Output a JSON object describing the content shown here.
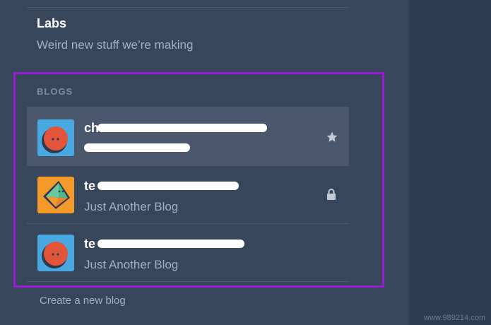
{
  "labs": {
    "title": "Labs",
    "subtitle": "Weird new stuff we’re making"
  },
  "blogs_section": {
    "header": "BLOGS",
    "items": [
      {
        "name_visible": "ch",
        "subtitle_visible": "",
        "avatar": "red-face-avatar",
        "status_icon": "star-icon",
        "active": true
      },
      {
        "name_visible": "te",
        "subtitle_visible": "Just Another Blog",
        "avatar": "orange-diamond-avatar",
        "status_icon": "lock-icon",
        "active": false
      },
      {
        "name_visible": "te",
        "subtitle_visible": "Just Another Blog",
        "avatar": "red-face-avatar",
        "status_icon": "",
        "active": false
      }
    ]
  },
  "create_link": "Create a new blog",
  "watermark": "www.989214.com",
  "colors": {
    "panel_bg": "#37465b",
    "active_row_bg": "#4a576d",
    "highlight_border": "#9b1ad8",
    "avatar_blue": "#4aa8e0",
    "avatar_orange": "#f39a2a"
  }
}
